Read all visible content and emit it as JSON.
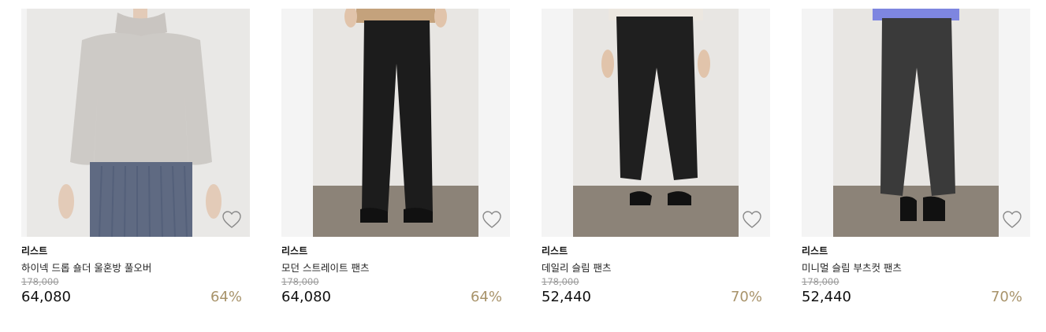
{
  "products": [
    {
      "brand": "리스트",
      "name": "하이넥 드롭 숄더 울혼방 풀오버",
      "original_price": "178,000",
      "price": "64,080",
      "discount": "64%",
      "wishlist_icon": "heart-outline-icon"
    },
    {
      "brand": "리스트",
      "name": "모던 스트레이트 팬츠",
      "original_price": "178,000",
      "price": "64,080",
      "discount": "64%",
      "wishlist_icon": "heart-outline-icon"
    },
    {
      "brand": "리스트",
      "name": "데일리 슬림 팬츠",
      "original_price": "178,000",
      "price": "52,440",
      "discount": "70%",
      "wishlist_icon": "heart-outline-icon"
    },
    {
      "brand": "리스트",
      "name": "미니멀 슬림 부츠컷 팬츠",
      "original_price": "178,000",
      "price": "52,440",
      "discount": "70%",
      "wishlist_icon": "heart-outline-icon"
    }
  ],
  "colors": {
    "discount": "#a8936a",
    "original_price": "#9a9a9a",
    "text": "#111111"
  }
}
